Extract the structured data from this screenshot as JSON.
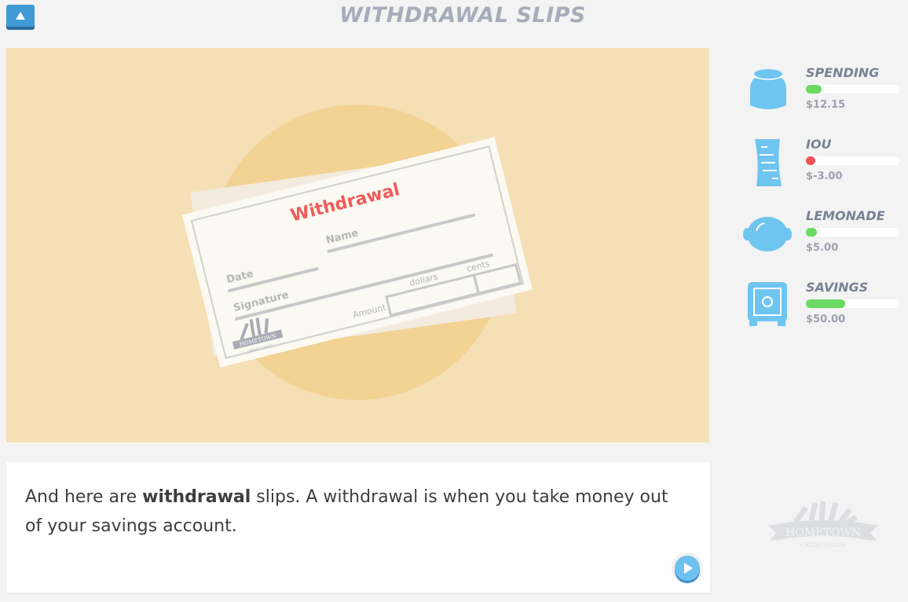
{
  "header": {
    "title": "WITHDRAWAL SLIPS",
    "up_icon": "triangle-up-icon"
  },
  "illustration": {
    "slip_title": "Withdrawal",
    "fields": {
      "date": "Date",
      "name": "Name",
      "signature": "Signature",
      "amount": "Amount",
      "dollars": "dollars",
      "cents": "cents"
    },
    "logo_text": "HOMETOWN",
    "logo_subtext": "CREDIT UNION",
    "colors": {
      "background": "#f5dfb5",
      "circle": "#f2d394",
      "slip_title": "#f25a5a"
    }
  },
  "narration": {
    "before": "And here are ",
    "bold": "withdrawal",
    "after": " slips. A withdrawal is when you take money out of your savings account.",
    "play_icon": "play-icon"
  },
  "accounts": [
    {
      "name": "SPENDING",
      "amount": "$12.15",
      "fill": 0.17,
      "color": "#6bd962",
      "icon": "jar-icon"
    },
    {
      "name": "IOU",
      "amount": "$-3.00",
      "fill": 0.1,
      "color": "#f25555",
      "icon": "receipt-icon"
    },
    {
      "name": "LEMONADE",
      "amount": "$5.00",
      "fill": 0.12,
      "color": "#6bd962",
      "icon": "lemon-icon"
    },
    {
      "name": "SAVINGS",
      "amount": "$50.00",
      "fill": 0.42,
      "color": "#6bd962",
      "icon": "safe-icon"
    }
  ],
  "brand": {
    "logo_text": "HOMETOWN",
    "logo_subtext": "CREDIT UNION"
  }
}
